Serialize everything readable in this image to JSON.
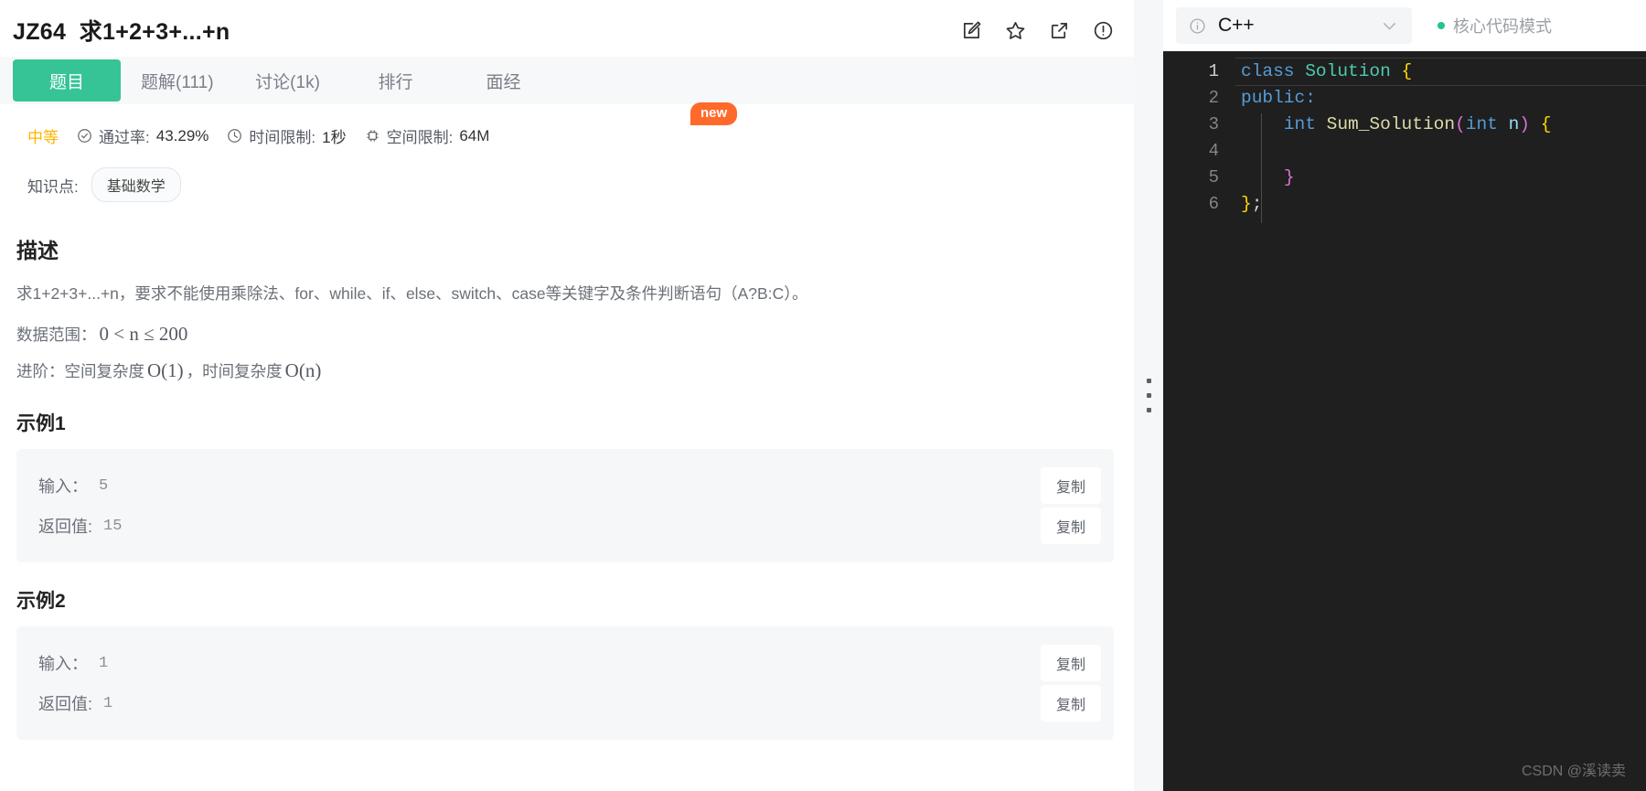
{
  "problem": {
    "id": "JZ64",
    "title": "求1+2+3+...+n",
    "actions": [
      {
        "name": "edit-icon",
        "label": "编辑"
      },
      {
        "name": "star-icon",
        "label": "收藏"
      },
      {
        "name": "share-icon",
        "label": "分享"
      },
      {
        "name": "info-circle-icon",
        "label": "反馈"
      }
    ]
  },
  "tabs": [
    {
      "label": "题目",
      "active": true
    },
    {
      "label": "题解(111)",
      "active": false
    },
    {
      "label": "讨论(1k)",
      "active": false
    },
    {
      "label": "排行",
      "active": false
    },
    {
      "label": "面经",
      "active": false
    }
  ],
  "new_badge": "new",
  "meta": {
    "difficulty": "中等",
    "pass_rate_label": "通过率:",
    "pass_rate_value": "43.29%",
    "time_limit_label": "时间限制:",
    "time_limit_value": "1秒",
    "space_limit_label": "空间限制:",
    "space_limit_value": "64M",
    "knowledge_label": "知识点:",
    "knowledge_tags": [
      "基础数学"
    ]
  },
  "description": {
    "heading": "描述",
    "paragraph": "求1+2+3+...+n，要求不能使用乘除法、for、while、if、else、switch、case等关键字及条件判断语句（A?B:C）。",
    "range_label": "数据范围：",
    "range_math": "0 < n ≤ 200",
    "advance_label": "进阶：",
    "advance_space_label": "空间复杂度",
    "advance_space_math": "O(1)",
    "advance_sep": "，",
    "advance_time_label": "时间复杂度",
    "advance_time_math": "O(n)"
  },
  "examples": [
    {
      "title": "示例1",
      "input_label": "输入：",
      "input_value": "5",
      "output_label": "返回值:",
      "output_value": "15",
      "copy_label": "复制"
    },
    {
      "title": "示例2",
      "input_label": "输入：",
      "input_value": "1",
      "output_label": "返回值:",
      "output_value": "1",
      "copy_label": "复制"
    }
  ],
  "editor": {
    "language": "C++",
    "mode_label": "核心代码模式",
    "mode_dot_color": "#22c58b",
    "background": "#1f1f1f",
    "lines": [
      {
        "num": "1",
        "current": true,
        "tokens": [
          {
            "t": "class ",
            "c": "k-key"
          },
          {
            "t": "Solution ",
            "c": "k-type"
          },
          {
            "t": "{",
            "c": "k-brace"
          }
        ]
      },
      {
        "num": "2",
        "current": false,
        "tokens": [
          {
            "t": "public:",
            "c": "k-key"
          }
        ]
      },
      {
        "num": "3",
        "current": false,
        "tokens": [
          {
            "t": "    ",
            "c": "k-plain"
          },
          {
            "t": "int ",
            "c": "k-key"
          },
          {
            "t": "Sum_Solution",
            "c": "k-fn"
          },
          {
            "t": "(",
            "c": "k-paren"
          },
          {
            "t": "int ",
            "c": "k-key"
          },
          {
            "t": "n",
            "c": "k-var"
          },
          {
            "t": ")",
            "c": "k-paren"
          },
          {
            "t": " ",
            "c": "k-plain"
          },
          {
            "t": "{",
            "c": "k-brace"
          }
        ]
      },
      {
        "num": "4",
        "current": false,
        "tokens": [
          {
            "t": "",
            "c": "k-plain"
          }
        ]
      },
      {
        "num": "5",
        "current": false,
        "tokens": [
          {
            "t": "    ",
            "c": "k-plain"
          },
          {
            "t": "}",
            "c": "k-paren"
          }
        ]
      },
      {
        "num": "6",
        "current": false,
        "tokens": [
          {
            "t": "}",
            "c": "k-brace"
          },
          {
            "t": ";",
            "c": "k-plain"
          }
        ]
      }
    ]
  },
  "watermark": "CSDN @溪读卖"
}
